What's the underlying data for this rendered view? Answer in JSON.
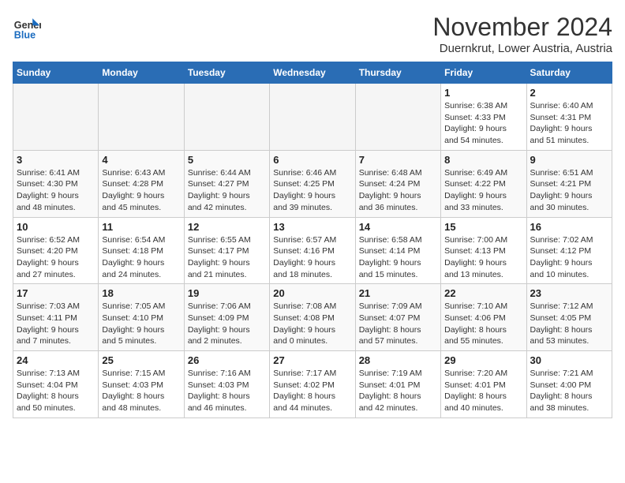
{
  "header": {
    "logo_line1": "General",
    "logo_line2": "Blue",
    "month_year": "November 2024",
    "location": "Duernkrut, Lower Austria, Austria"
  },
  "weekdays": [
    "Sunday",
    "Monday",
    "Tuesday",
    "Wednesday",
    "Thursday",
    "Friday",
    "Saturday"
  ],
  "weeks": [
    [
      {
        "day": "",
        "info": ""
      },
      {
        "day": "",
        "info": ""
      },
      {
        "day": "",
        "info": ""
      },
      {
        "day": "",
        "info": ""
      },
      {
        "day": "",
        "info": ""
      },
      {
        "day": "1",
        "info": "Sunrise: 6:38 AM\nSunset: 4:33 PM\nDaylight: 9 hours\nand 54 minutes."
      },
      {
        "day": "2",
        "info": "Sunrise: 6:40 AM\nSunset: 4:31 PM\nDaylight: 9 hours\nand 51 minutes."
      }
    ],
    [
      {
        "day": "3",
        "info": "Sunrise: 6:41 AM\nSunset: 4:30 PM\nDaylight: 9 hours\nand 48 minutes."
      },
      {
        "day": "4",
        "info": "Sunrise: 6:43 AM\nSunset: 4:28 PM\nDaylight: 9 hours\nand 45 minutes."
      },
      {
        "day": "5",
        "info": "Sunrise: 6:44 AM\nSunset: 4:27 PM\nDaylight: 9 hours\nand 42 minutes."
      },
      {
        "day": "6",
        "info": "Sunrise: 6:46 AM\nSunset: 4:25 PM\nDaylight: 9 hours\nand 39 minutes."
      },
      {
        "day": "7",
        "info": "Sunrise: 6:48 AM\nSunset: 4:24 PM\nDaylight: 9 hours\nand 36 minutes."
      },
      {
        "day": "8",
        "info": "Sunrise: 6:49 AM\nSunset: 4:22 PM\nDaylight: 9 hours\nand 33 minutes."
      },
      {
        "day": "9",
        "info": "Sunrise: 6:51 AM\nSunset: 4:21 PM\nDaylight: 9 hours\nand 30 minutes."
      }
    ],
    [
      {
        "day": "10",
        "info": "Sunrise: 6:52 AM\nSunset: 4:20 PM\nDaylight: 9 hours\nand 27 minutes."
      },
      {
        "day": "11",
        "info": "Sunrise: 6:54 AM\nSunset: 4:18 PM\nDaylight: 9 hours\nand 24 minutes."
      },
      {
        "day": "12",
        "info": "Sunrise: 6:55 AM\nSunset: 4:17 PM\nDaylight: 9 hours\nand 21 minutes."
      },
      {
        "day": "13",
        "info": "Sunrise: 6:57 AM\nSunset: 4:16 PM\nDaylight: 9 hours\nand 18 minutes."
      },
      {
        "day": "14",
        "info": "Sunrise: 6:58 AM\nSunset: 4:14 PM\nDaylight: 9 hours\nand 15 minutes."
      },
      {
        "day": "15",
        "info": "Sunrise: 7:00 AM\nSunset: 4:13 PM\nDaylight: 9 hours\nand 13 minutes."
      },
      {
        "day": "16",
        "info": "Sunrise: 7:02 AM\nSunset: 4:12 PM\nDaylight: 9 hours\nand 10 minutes."
      }
    ],
    [
      {
        "day": "17",
        "info": "Sunrise: 7:03 AM\nSunset: 4:11 PM\nDaylight: 9 hours\nand 7 minutes."
      },
      {
        "day": "18",
        "info": "Sunrise: 7:05 AM\nSunset: 4:10 PM\nDaylight: 9 hours\nand 5 minutes."
      },
      {
        "day": "19",
        "info": "Sunrise: 7:06 AM\nSunset: 4:09 PM\nDaylight: 9 hours\nand 2 minutes."
      },
      {
        "day": "20",
        "info": "Sunrise: 7:08 AM\nSunset: 4:08 PM\nDaylight: 9 hours\nand 0 minutes."
      },
      {
        "day": "21",
        "info": "Sunrise: 7:09 AM\nSunset: 4:07 PM\nDaylight: 8 hours\nand 57 minutes."
      },
      {
        "day": "22",
        "info": "Sunrise: 7:10 AM\nSunset: 4:06 PM\nDaylight: 8 hours\nand 55 minutes."
      },
      {
        "day": "23",
        "info": "Sunrise: 7:12 AM\nSunset: 4:05 PM\nDaylight: 8 hours\nand 53 minutes."
      }
    ],
    [
      {
        "day": "24",
        "info": "Sunrise: 7:13 AM\nSunset: 4:04 PM\nDaylight: 8 hours\nand 50 minutes."
      },
      {
        "day": "25",
        "info": "Sunrise: 7:15 AM\nSunset: 4:03 PM\nDaylight: 8 hours\nand 48 minutes."
      },
      {
        "day": "26",
        "info": "Sunrise: 7:16 AM\nSunset: 4:03 PM\nDaylight: 8 hours\nand 46 minutes."
      },
      {
        "day": "27",
        "info": "Sunrise: 7:17 AM\nSunset: 4:02 PM\nDaylight: 8 hours\nand 44 minutes."
      },
      {
        "day": "28",
        "info": "Sunrise: 7:19 AM\nSunset: 4:01 PM\nDaylight: 8 hours\nand 42 minutes."
      },
      {
        "day": "29",
        "info": "Sunrise: 7:20 AM\nSunset: 4:01 PM\nDaylight: 8 hours\nand 40 minutes."
      },
      {
        "day": "30",
        "info": "Sunrise: 7:21 AM\nSunset: 4:00 PM\nDaylight: 8 hours\nand 38 minutes."
      }
    ]
  ]
}
